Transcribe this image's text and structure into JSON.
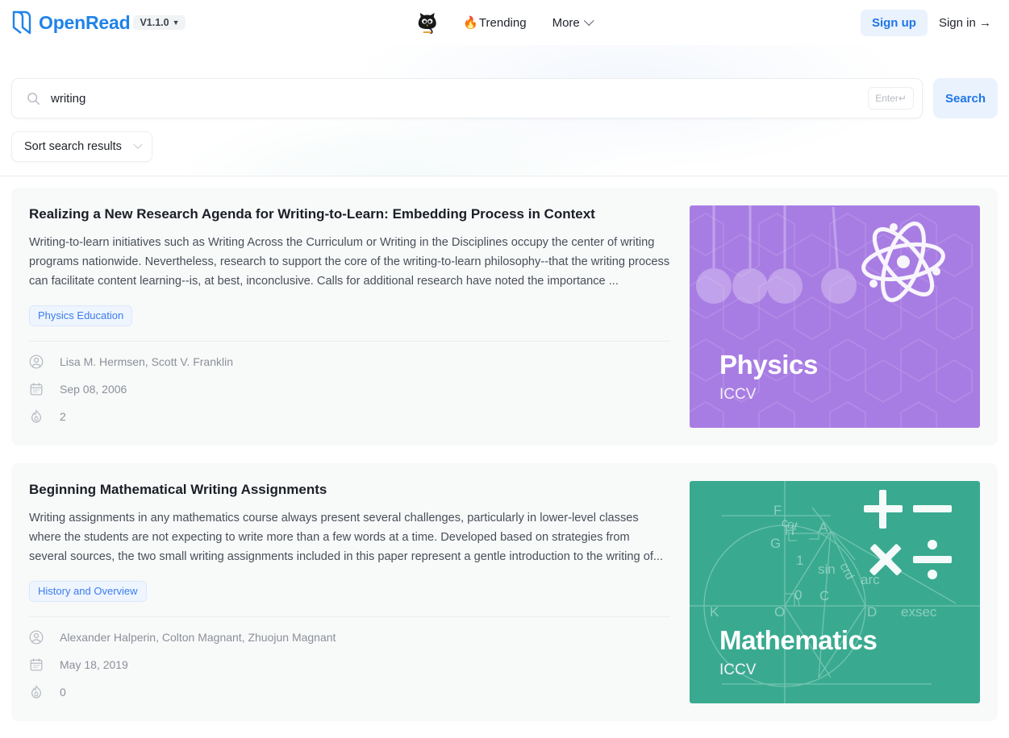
{
  "header": {
    "brand_name": "OpenRead",
    "logo_icon": "openread-logo-icon",
    "version": "V1.1.0",
    "version_caret": "▼",
    "cat_icon": "black-cat-icon",
    "trending_flame": "🔥",
    "trending_label": "Trending",
    "more_label": "More",
    "signup_label": "Sign up",
    "signin_label": "Sign in →"
  },
  "search": {
    "icon": "search-icon",
    "value": "writing",
    "placeholder": "Search",
    "enter_hint": "Enter↵",
    "button_label": "Search",
    "sort_label": "Sort search results",
    "sort_caret_icon": "chevron-down-icon"
  },
  "results": [
    {
      "title": "Realizing a New Research Agenda for Writing-to-Learn: Embedding Process in Context",
      "abstract": "Writing-to-learn initiatives such as Writing Across the Curriculum or Writing in the Disciplines occupy the center of writing programs nationwide. Nevertheless, research to support the core of the writing-to-learn philosophy--that the writing process can facilitate content learning--is, at best, inconclusive. Calls for additional research have noted the importance ...",
      "tag": "Physics Education",
      "authors": "Lisa M. Hermsen, Scott V. Franklin",
      "date": "Sep 08, 2006",
      "hot_count": "2",
      "author_icon": "user-circle-icon",
      "date_icon": "calendar-icon",
      "hot_icon": "flame-icon",
      "thumbnail": {
        "subject": "Physics",
        "venue": "ICCV",
        "color": "#A87DE3",
        "style": "physics"
      }
    },
    {
      "title": "Beginning Mathematical Writing Assignments",
      "abstract": "Writing assignments in any mathematics course always present several challenges, particularly in lower-level classes where the students are not expecting to write more than a few words at a time. Developed based on strategies from several sources, the two small writing assignments included in this paper represent a gentle introduction to the writing of...",
      "tag": "History and Overview",
      "authors": "Alexander Halperin, Colton Magnant, Zhuojun Magnant",
      "date": "May 18, 2019",
      "hot_count": "0",
      "author_icon": "user-circle-icon",
      "date_icon": "calendar-icon",
      "hot_icon": "flame-icon",
      "thumbnail": {
        "subject": "Mathematics",
        "venue": "ICCV",
        "color": "#39AA90",
        "style": "math"
      }
    }
  ],
  "colors": {
    "accent_blue": "#2076E8",
    "accent_blue_bg": "#EAF2FE",
    "card_bg": "#F8F9F9",
    "physics_purple": "#A87DE3",
    "math_teal": "#39AA90"
  }
}
